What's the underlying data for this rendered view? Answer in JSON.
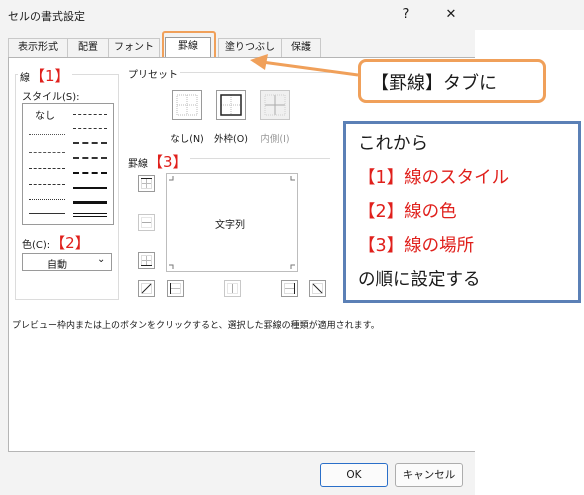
{
  "window": {
    "title": "セルの書式設定",
    "help_btn": "?",
    "close_btn": "✕"
  },
  "tabs": [
    {
      "label": "表示形式"
    },
    {
      "label": "配置"
    },
    {
      "label": "フォント"
    },
    {
      "label": "罫線"
    },
    {
      "label": "塗りつぶし"
    },
    {
      "label": "保護"
    }
  ],
  "active_tab": "罫線",
  "line_section": {
    "heading": "線",
    "annotation": "【1】",
    "style_label": "スタイル(S):",
    "none_label": "なし",
    "color_label": "色(C):",
    "color_annotation": "【2】",
    "color_value": "自動"
  },
  "preset_section": {
    "heading": "プリセット",
    "buttons": [
      {
        "label": "なし(N)"
      },
      {
        "label": "外枠(O)"
      },
      {
        "label": "内側(I)"
      }
    ]
  },
  "border_section": {
    "heading": "罫線",
    "annotation": "【3】",
    "preview_text": "文字列"
  },
  "hint_text": "プレビュー枠内または上のボタンをクリックすると、選択した罫線の種類が適用されます。",
  "footer": {
    "ok": "OK",
    "cancel": "キャンセル"
  },
  "callout": {
    "text": "【罫線】タブに"
  },
  "note": {
    "line1": "これから",
    "line2": "【1】線のスタイル",
    "line3": "【2】線の色",
    "line4": "【3】線の場所",
    "line5": "の順に設定する"
  },
  "colors": {
    "annotation_red": "#e0201c",
    "callout_orange": "#f0a05a",
    "note_blue": "#5b80b6"
  }
}
